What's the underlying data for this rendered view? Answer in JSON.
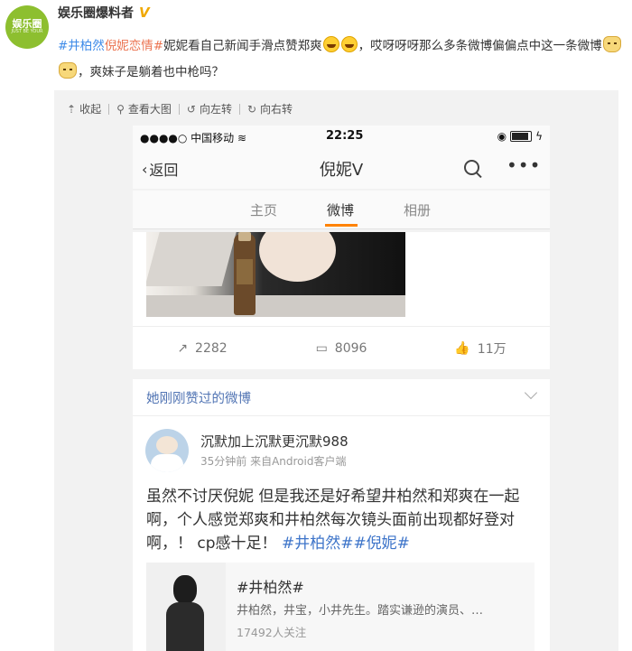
{
  "post": {
    "author": "娱乐圈爆料者",
    "verified_badge": "V",
    "avatar_text": "娱乐圈",
    "avatar_sub": "JUST BE YOUR",
    "text_tag1": "#井柏然",
    "text_tag2": "倪妮恋情#",
    "text_part1": "妮妮看自己新闻手滑点赞郑爽",
    "text_part2": "，哎呀呀呀那么多条微博偏偏点中这一条微博",
    "text_part3": "，爽妹子是躺着也中枪吗？"
  },
  "viewer_toolbar": {
    "collapse": "收起",
    "view_large": "查看大图",
    "rotate_left": "向左转",
    "rotate_right": "向右转"
  },
  "phone": {
    "status": {
      "carrier": "●●●●○ 中国移动",
      "time": "22:25"
    },
    "nav": {
      "back": "返回",
      "title": "倪妮V"
    },
    "tabs": [
      "主页",
      "微博",
      "相册"
    ],
    "active_tab": "微博",
    "feed_actions": {
      "reposts": "2282",
      "comments": "8096",
      "likes": "11万"
    },
    "liked_section_title": "她刚刚赞过的微博",
    "liked_post": {
      "user": "沉默加上沉默更沉默988",
      "meta": "35分钟前  来自Android客户端",
      "text": "虽然不讨厌倪妮 但是我还是好希望井柏然和郑爽在一起啊，个人感觉郑爽和井柏然每次镜头面前出现都好登对啊，！ cp感十足！",
      "tags": "#井柏然##倪妮#",
      "embed_title": "#井柏然#",
      "embed_desc": "井柏然，井宝，小井先生。踏实谦逊的演员、…",
      "embed_followers": "17492人关注"
    }
  },
  "colors": {
    "tag_orange": "#eb7350",
    "tag_blue": "#3d8ae8",
    "tab_active_bar": "#ff8200",
    "link_blue": "#5275b4"
  },
  "icons": [
    "collapse-icon",
    "magnifier-icon",
    "rotate-left-icon",
    "rotate-right-icon",
    "wifi-icon",
    "battery-icon",
    "back-chevron-icon",
    "search-icon",
    "more-icon",
    "repost-icon",
    "comment-icon",
    "like-icon",
    "chevron-down-icon"
  ]
}
